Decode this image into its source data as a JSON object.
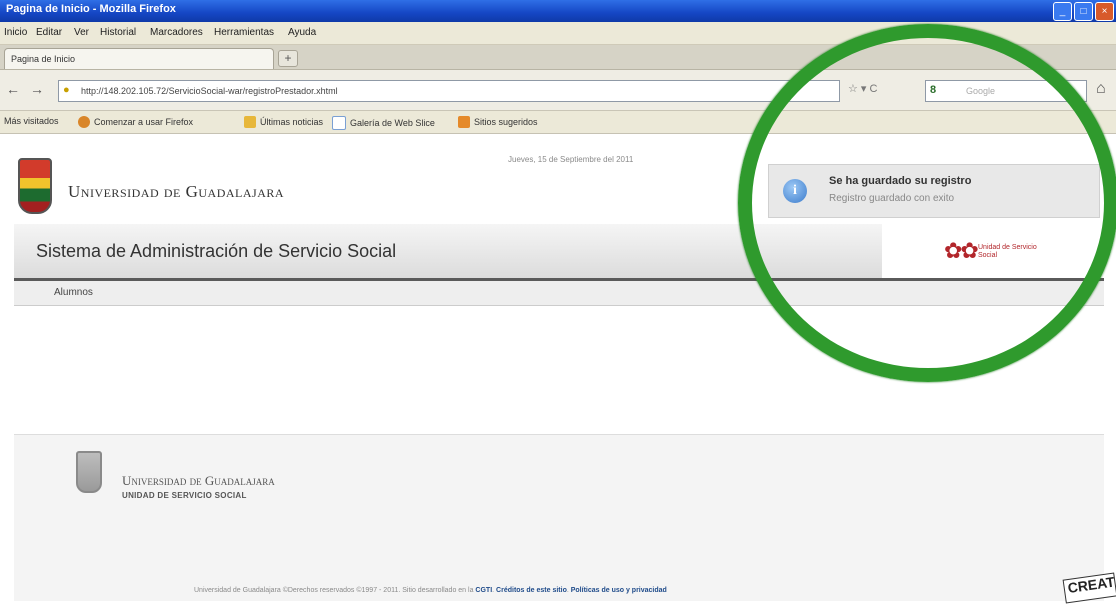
{
  "window": {
    "title": "Pagina de Inicio - Mozilla Firefox",
    "buttons": [
      "_",
      "□",
      "×"
    ]
  },
  "menubar": [
    "Inicio",
    "Editar",
    "Ver",
    "Historial",
    "Marcadores",
    "Herramientas",
    "Ayuda"
  ],
  "tab": {
    "label": "Pagina de Inicio",
    "new_tab": "+"
  },
  "nav": {
    "back": "←",
    "forward": "→",
    "url": "http://148.202.105.72/ServicioSocial-war/registroPrestador.xhtml",
    "star_reload": "☆ ▾ C",
    "search_engine": "8",
    "search_placeholder": "Google",
    "home": "⌂"
  },
  "bookmarks": [
    {
      "label": "Más visitados",
      "color": ""
    },
    {
      "label": "Comenzar a usar Firefox",
      "color": "#d9862a"
    },
    {
      "label": "Últimas noticias",
      "color": "#e7b73a"
    },
    {
      "label": "Galería de Web Slice",
      "color": "#7aa0d4"
    },
    {
      "label": "Sitios sugeridos",
      "color": "#e58a2a"
    }
  ],
  "header": {
    "logo_text": "Universidad de Guadalajara",
    "date_line": "Jueves, 15 de Septiembre del 2011"
  },
  "system": {
    "title": "Sistema de Administración de Servicio Social",
    "right_logo_text": "Unidad de Servicio Social"
  },
  "menu": {
    "item": "Alumnos"
  },
  "notice": {
    "icon": "i",
    "heading": "Se ha guardado su registro",
    "subtitle": "Registro guardado con exito"
  },
  "footer": {
    "logo_text": "Universidad de Guadalajara",
    "unit": "UNIDAD DE SERVICIO SOCIAL",
    "copyright": "Universidad de Guadalajara ©Derechos reservados ©1997 - 2011. Sitio desarrollado en la",
    "links": [
      "CGTI",
      "Créditos de este sitio",
      "Políticas de uso y privacidad"
    ]
  },
  "watermark": "CREAT"
}
